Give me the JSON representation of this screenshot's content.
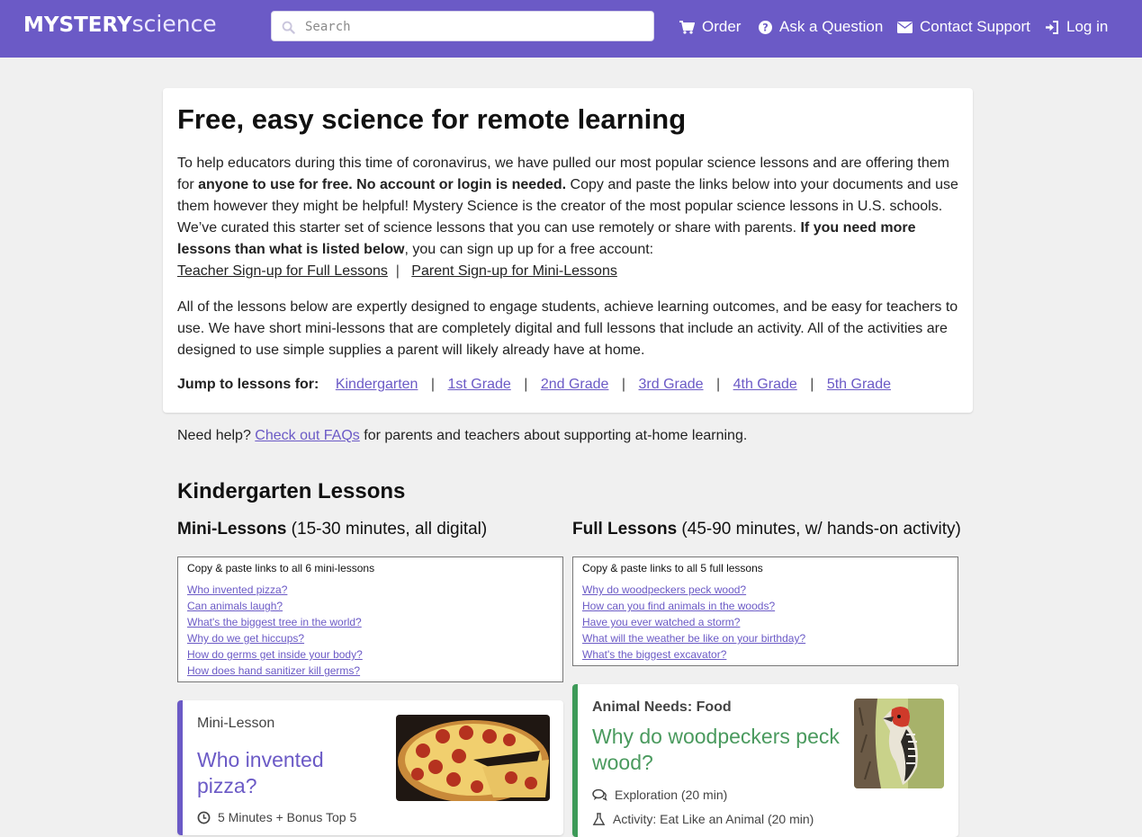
{
  "header": {
    "logo_bold": "MYSTERY",
    "logo_light": "science",
    "search_placeholder": "Search",
    "nav": {
      "order": "Order",
      "ask": "Ask a Question",
      "contact": "Contact Support",
      "login": "Log in"
    }
  },
  "intro": {
    "title": "Free, easy science for remote learning",
    "p1": {
      "l1_a": "To help educators during this time of coronavirus, we have pulled our most popular science lessons and are offering them",
      "l2_a": "for ",
      "l2_b": "anyone to use for free. No account or login is needed.",
      "l2_c": " Copy and paste the links below into your documents and use",
      "l3": "them however they might be helpful! Mystery Science is the creator of the most popular science lessons in U.S. schools.",
      "l4_a": "We’ve curated this starter set of science lessons that you can use remotely or share with parents. ",
      "l4_b": "If you need more",
      "l5_a": "lessons than what is listed below",
      "l5_b": ", you can sign up up for a free account:",
      "teacher_link": "Teacher Sign-up for Full Lessons",
      "divider": "|",
      "parent_link": "Parent Sign-up for Mini-Lessons"
    },
    "p2": {
      "l1": "All of the lessons below are expertly designed to engage students, achieve learning outcomes, and be easy for teachers to",
      "l2": "use. We have short mini-lessons that are completely digital and full lessons that include an activity. All of the activities are",
      "l3": "designed to use simple supplies a parent will likely already have at home."
    },
    "jump": {
      "label": "Jump to lessons for:",
      "grades": [
        "Kindergarten",
        "1st Grade",
        "2nd Grade",
        "3rd Grade",
        "4th Grade",
        "5th Grade"
      ],
      "sep": "|"
    }
  },
  "help": {
    "pre": "Need help? ",
    "link": "Check out FAQs",
    "post": " for parents and teachers about supporting at-home learning."
  },
  "kinder": {
    "heading": "Kindergarten Lessons",
    "mini": {
      "head_bold": "Mini-Lessons",
      "head_rest": " (15-30 minutes, all digital)",
      "box_title": "Copy & paste links to all 6 mini-lessons",
      "links": [
        "Who invented pizza?",
        "Can animals laugh?",
        "What's the biggest tree in the world?",
        "Why do we get hiccups?",
        "How do germs get inside your body?",
        "How does hand sanitizer kill germs?"
      ],
      "card": {
        "kicker": "Mini-Lesson",
        "title_l1": "Who invented",
        "title_l2": "pizza?",
        "meta": "5 Minutes + Bonus Top 5"
      }
    },
    "full": {
      "head_bold": "Full Lessons",
      "head_rest": " (45-90 minutes, w/ hands-on activity)",
      "box_title": "Copy & paste links to all 5 full lessons",
      "links": [
        "Why do woodpeckers peck wood?",
        "How can you find animals in the woods?",
        "Have you ever watched a storm?",
        "What will the weather be like on your birthday?",
        "What's the biggest excavator?"
      ],
      "card": {
        "kicker": "Animal Needs: Food",
        "title_l1": "Why do woodpeckers peck",
        "title_l2": "wood?",
        "meta1": "Exploration (20 min)",
        "meta2": "Activity: Eat Like an Animal (20 min)"
      }
    }
  },
  "colors": {
    "brand": "#6b5ac6",
    "mini_accent": "#6b5ac6",
    "full_accent": "#3d9a58",
    "full_title": "#4a9a5e"
  }
}
